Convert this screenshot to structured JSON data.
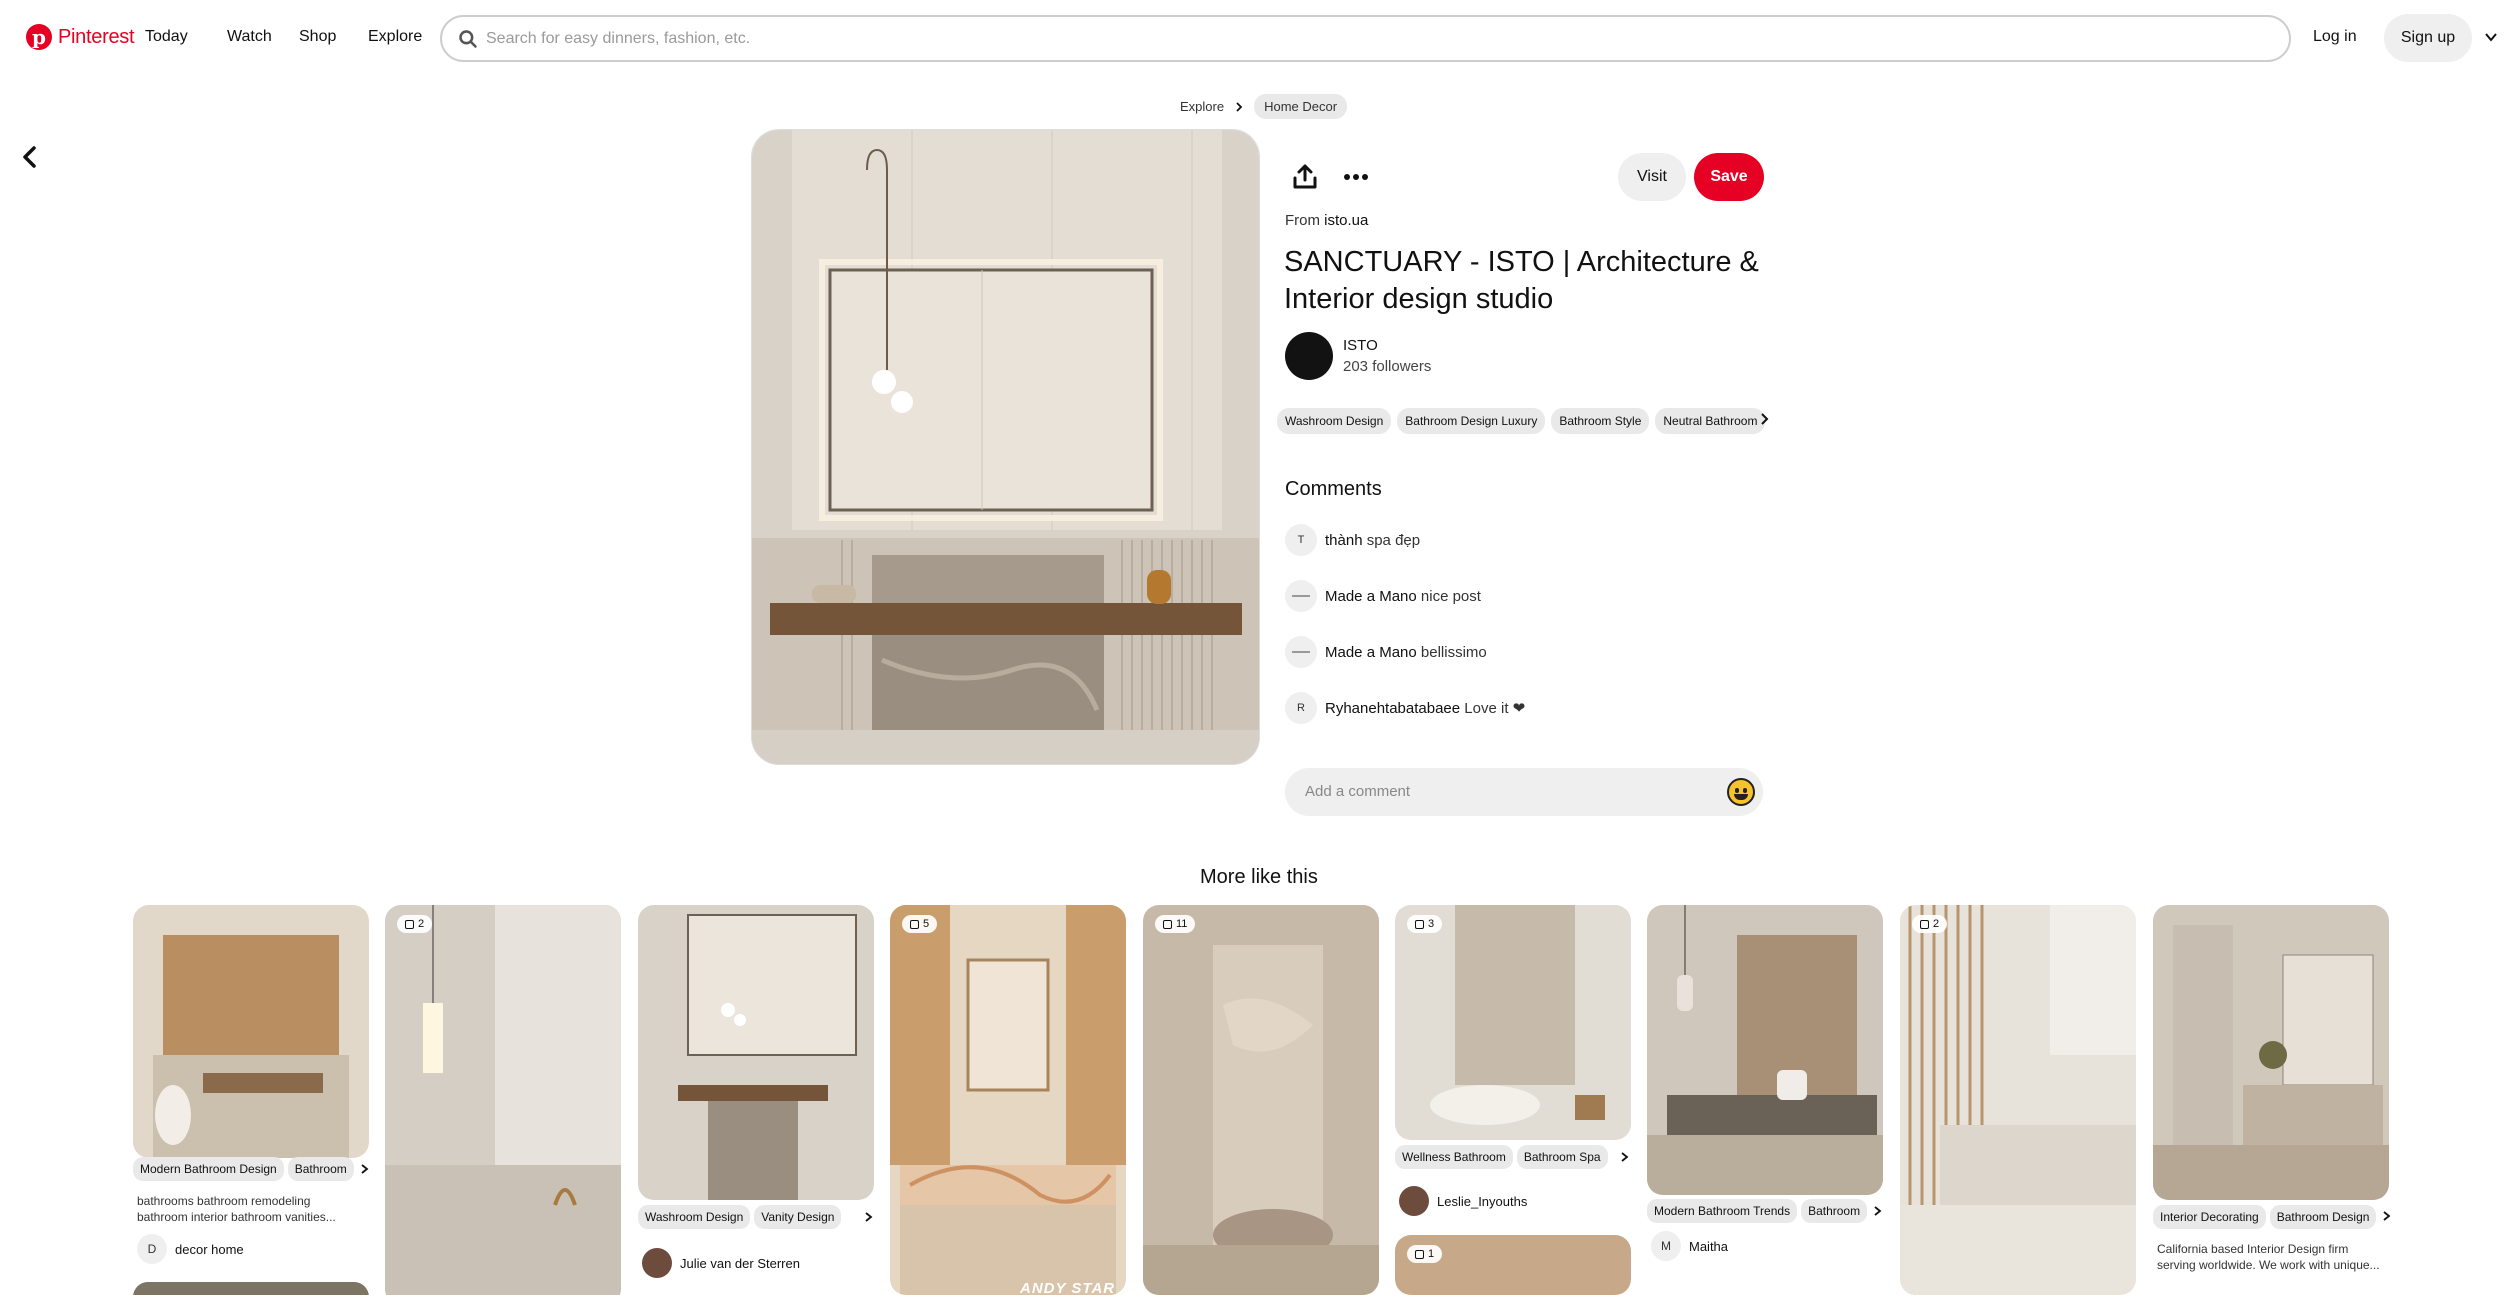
{
  "header": {
    "brand": "Pinterest",
    "nav": {
      "today": "Today",
      "watch": "Watch",
      "shop": "Shop",
      "explore": "Explore"
    },
    "search_placeholder": "Search for easy dinners, fashion, etc.",
    "login": "Log in",
    "signup": "Sign up"
  },
  "breadcrumb": {
    "explore": "Explore",
    "category": "Home Decor"
  },
  "pin": {
    "visit": "Visit",
    "save": "Save",
    "from_prefix": "From",
    "source": "isto.ua",
    "title": "SANCTUARY - ISTO | Architecture & Interior design studio",
    "author": {
      "name": "ISTO",
      "followers": "203 followers"
    },
    "tags": [
      "Washroom Design",
      "Bathroom Design Luxury",
      "Bathroom Style",
      "Neutral Bathroom"
    ]
  },
  "comments": {
    "heading": "Comments",
    "items": [
      {
        "avatar": "T",
        "user": "thành",
        "text": "spa đẹp"
      },
      {
        "avatar": "",
        "user": "Made a Mano",
        "text": "nice post"
      },
      {
        "avatar": "",
        "user": "Made a Mano",
        "text": "bellissimo"
      },
      {
        "avatar": "R",
        "user": "Ryhanehtabatabaee",
        "text": "Love it ❤"
      }
    ],
    "add_placeholder": "Add a comment"
  },
  "more": {
    "heading": "More like this",
    "cards": [
      {
        "tags": [
          "Modern Bathroom Design",
          "Bathroom"
        ],
        "desc": "bathrooms bathroom remodeling bathroom interior bathroom vanities...",
        "user_initial": "D",
        "user": "decor home"
      },
      {
        "badge": "2"
      },
      {
        "tags": [
          "Washroom Design",
          "Vanity Design"
        ],
        "user": "Julie van der Sterren"
      },
      {
        "badge": "5",
        "overlay": "ANDY STAR"
      },
      {
        "badge": "11"
      },
      {
        "badge": "3",
        "tags": [
          "Wellness Bathroom",
          "Bathroom Spa"
        ],
        "user": "Leslie_Inyouths"
      },
      {
        "tags": [
          "Modern Bathroom Trends",
          "Bathroom"
        ],
        "user_initial": "M",
        "user": "Maitha"
      },
      {
        "badge": "2"
      },
      {
        "tags": [
          "Interior Decorating",
          "Bathroom Design"
        ],
        "desc": "California based Interior Design firm serving worldwide. We work with unique..."
      },
      {
        "badge": "1"
      }
    ]
  },
  "colors": {
    "brand": "#e60023",
    "pill": "#efefef"
  },
  "icons": [
    "pinterest-logo-icon",
    "search-icon",
    "chevron-down-icon",
    "back-arrow-icon",
    "chevron-right-icon",
    "share-icon",
    "more-icon",
    "emoji-icon",
    "board-icon"
  ]
}
